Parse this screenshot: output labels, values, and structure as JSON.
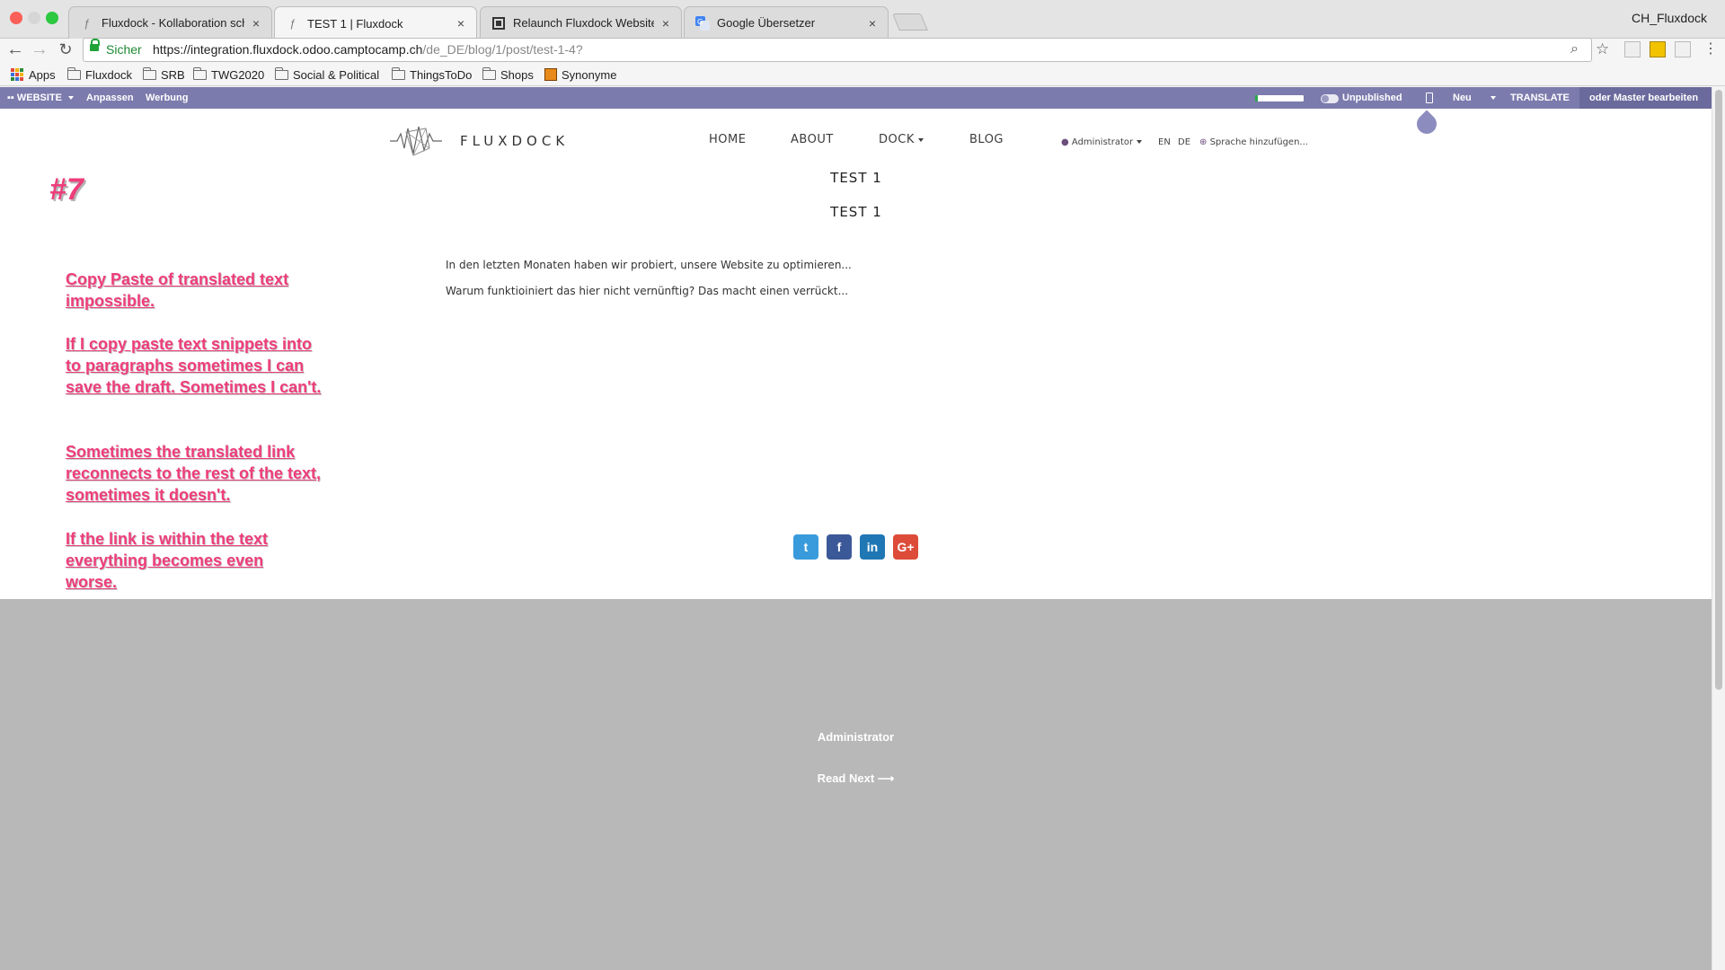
{
  "browser": {
    "tabs": [
      {
        "title": "Fluxdock - Kollaboration schaf",
        "close": "×",
        "favicon": "fluxdock-favicon"
      },
      {
        "title": "TEST 1 | Fluxdock",
        "close": "×",
        "favicon": "fluxdock-favicon",
        "active": true
      },
      {
        "title": "Relaunch Fluxdock Website | T",
        "close": "×",
        "favicon": "board-favicon"
      },
      {
        "title": "Google Übersetzer",
        "close": "×",
        "favicon": "google-translate-favicon"
      }
    ],
    "profile": "CH_Fluxdock",
    "secure_label": "Sicher",
    "url_host": "https://integration.fluxdock.odoo.camptocamp.ch",
    "url_path": "/de_DE/blog/1/post/test-1-4?"
  },
  "bookmarks": [
    {
      "label": "Apps",
      "icon": "apps-grid-icon"
    },
    {
      "label": "Fluxdock",
      "icon": "folder-icon"
    },
    {
      "label": "SRB",
      "icon": "folder-icon"
    },
    {
      "label": "TWG2020",
      "icon": "folder-icon"
    },
    {
      "label": "Social & Political",
      "icon": "folder-icon"
    },
    {
      "label": "ThingsToDo",
      "icon": "folder-icon"
    },
    {
      "label": "Shops",
      "icon": "folder-icon"
    },
    {
      "label": "Synonyme",
      "icon": "synonyme-icon"
    }
  ],
  "adminbar": {
    "website": "WEBSITE",
    "customize": "Anpassen",
    "promote": "Werbung",
    "progress_fraction": 0.05,
    "unpublished": "Unpublished",
    "new": "Neu",
    "translate": "TRANSLATE",
    "edit_master": "oder Master bearbeiten",
    "color": "#7c7bad"
  },
  "site": {
    "brand": "FLUXDOCK",
    "nav": [
      "HOME",
      "ABOUT",
      "DOCK",
      "BLOG"
    ],
    "user": "Administrator",
    "lang_en": "EN",
    "lang_de": "DE",
    "add_language": "Sprache hinzufügen..."
  },
  "post": {
    "title": "TEST 1",
    "subtitle": "TEST 1",
    "paragraphs": [
      "In den letzten Monaten  haben wir probiert, unsere Website zu optimieren...",
      "Warum funktioiniert das hier nicht vernünftig? Das macht einen verrückt..."
    ]
  },
  "annotations": {
    "marker": "#7",
    "notes": [
      "Copy Paste of translated text impossible.",
      "If I copy paste text snippets into to paragraphs sometimes I can save the draft. Sometimes I can't.",
      "Sometimes the translated link reconnects to the rest of the text, sometimes it doesn't.",
      "If the link is within the text everything becomes even worse."
    ],
    "color": "#ee3d7b"
  },
  "share": [
    {
      "icon": "twitter-icon",
      "glyph": "t",
      "color": "#3a9bdc"
    },
    {
      "icon": "facebook-icon",
      "glyph": "f",
      "color": "#3b5998"
    },
    {
      "icon": "linkedin-icon",
      "glyph": "in",
      "color": "#1f77b4"
    },
    {
      "icon": "googleplus-icon",
      "glyph": "G+",
      "color": "#dd4b39"
    }
  ],
  "footer": {
    "author": "Administrator",
    "read_next": "Read Next",
    "read_next_arrow": "⟶"
  }
}
